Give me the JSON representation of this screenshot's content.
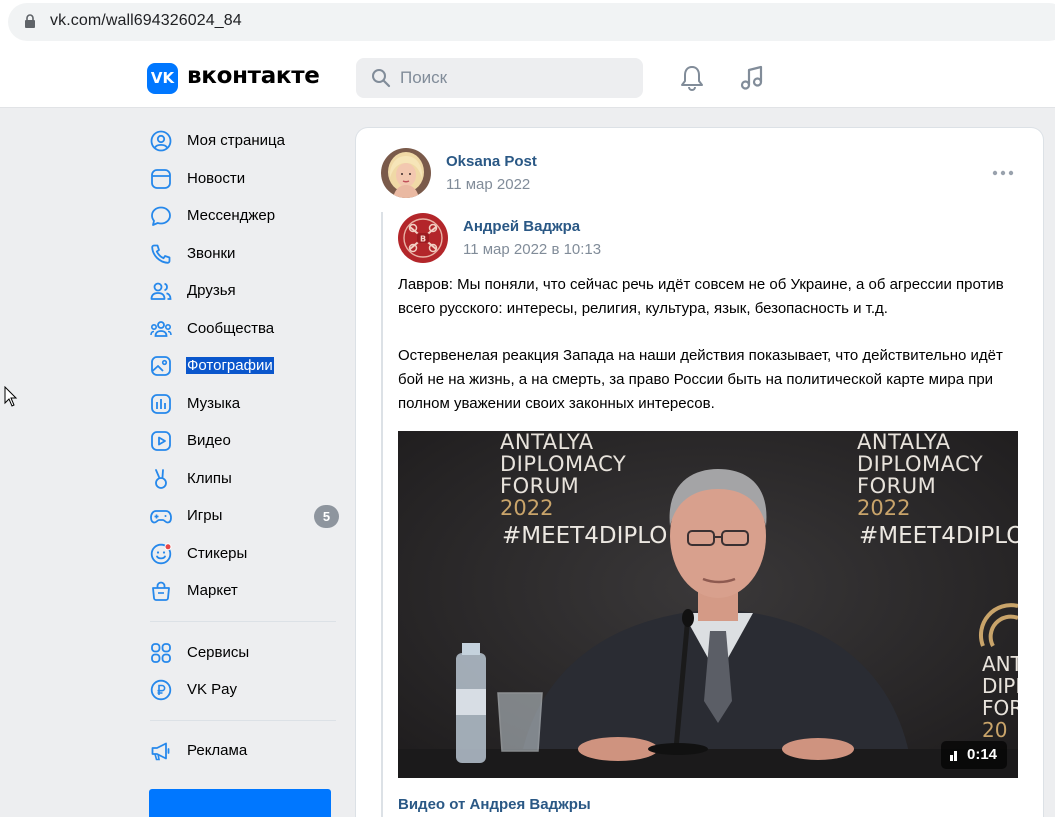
{
  "browser": {
    "url": "vk.com/wall694326024_84"
  },
  "header": {
    "logo_mark": "VK",
    "logo_text": "вконтакте",
    "search_placeholder": "Поиск"
  },
  "sidebar": {
    "items": [
      {
        "label": "Моя страница",
        "icon": "user-circle-icon"
      },
      {
        "label": "Новости",
        "icon": "news-icon"
      },
      {
        "label": "Мессенджер",
        "icon": "message-icon"
      },
      {
        "label": "Звонки",
        "icon": "phone-icon"
      },
      {
        "label": "Друзья",
        "icon": "friends-icon"
      },
      {
        "label": "Сообщества",
        "icon": "communities-icon"
      },
      {
        "label": "Фотографии",
        "icon": "photo-icon"
      },
      {
        "label": "Музыка",
        "icon": "music-wave-icon"
      },
      {
        "label": "Видео",
        "icon": "video-icon"
      },
      {
        "label": "Клипы",
        "icon": "clips-icon"
      },
      {
        "label": "Игры",
        "icon": "gamepad-icon",
        "badge": "5"
      },
      {
        "label": "Стикеры",
        "icon": "sticker-icon"
      },
      {
        "label": "Маркет",
        "icon": "market-icon"
      },
      {
        "label": "Сервисы",
        "icon": "services-icon"
      },
      {
        "label": "VK Pay",
        "icon": "vkpay-icon"
      },
      {
        "label": "Реклама",
        "icon": "megaphone-icon"
      }
    ]
  },
  "post": {
    "author": "Oksana Post",
    "date": "11 мар 2022",
    "repost": {
      "author": "Андрей Ваджра",
      "date": "11 мар 2022 в 10:13",
      "avatar_letter": "В",
      "paragraph1": "Лавров: Мы поняли, что сейчас речь идёт совсем не об Украине, а об агрессии против всего русского: интересы, религия, культура, язык, безопасность и т.д.",
      "paragraph2": "Остервенелая реакция Запада на наши действия показывает, что действительно идёт бой не на жизнь, а на смерть, за право России быть на политической карте мира при полном уважении своих законных интересов.",
      "video": {
        "duration": "0:14",
        "caption": "Видео от Андрея Ваджры",
        "banner_left": [
          "ANTALYA",
          "DIPLOMACY",
          "FORUM",
          "2022",
          "#MEET4DIPLO"
        ],
        "banner_right": [
          "ANTALYA",
          "DIPLOMACY",
          "FORUM",
          "2022",
          "#MEET4DIPLO"
        ],
        "banner_partial": [
          "ANT",
          "DIPLO",
          "FOR",
          "20"
        ]
      }
    }
  },
  "colors": {
    "accent": "#0077ff",
    "link": "#2a5885",
    "muted": "#818c99",
    "page_bg": "#edeef0",
    "selection": "#0a56cc",
    "badge": "#8e959e"
  }
}
